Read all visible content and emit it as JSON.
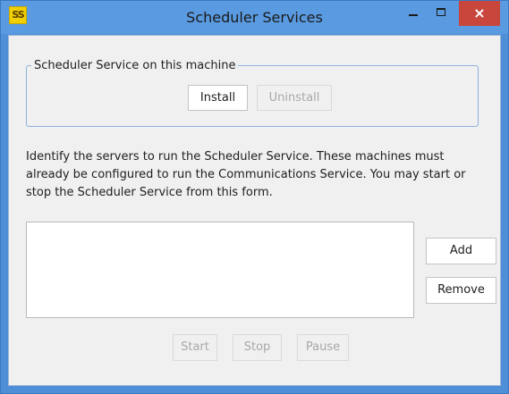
{
  "window": {
    "title": "Scheduler Services",
    "icon_text": "SS",
    "close_glyph": "×"
  },
  "group": {
    "legend": "Scheduler Service on this machine",
    "install_label": "Install",
    "uninstall_label": "Uninstall"
  },
  "description": "Identify the servers to run the Scheduler Service. These machines must already be configured to run the Communications Service. You may start or stop the Scheduler Service from this form.",
  "server_list": {
    "items": []
  },
  "buttons": {
    "add_label": "Add",
    "remove_label": "Remove",
    "start_label": "Start",
    "stop_label": "Stop",
    "pause_label": "Pause"
  }
}
